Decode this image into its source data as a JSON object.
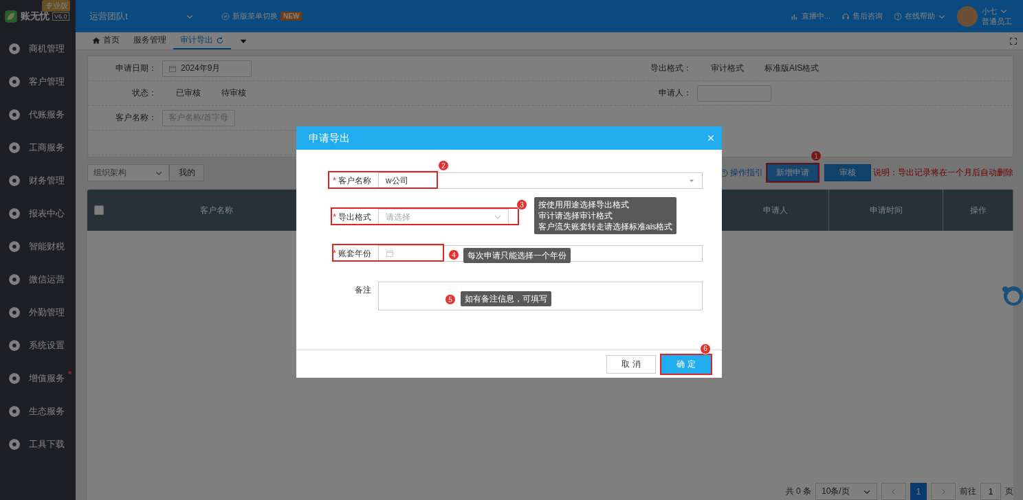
{
  "brand": {
    "name": "账无忧",
    "version": "V6.0",
    "edition": "专业版"
  },
  "topbar": {
    "team": "运营团队t",
    "menu_switch": "新版菜单切换",
    "badge": "NEW",
    "links": [
      {
        "kind": "live",
        "label": "直播中..."
      },
      {
        "kind": "support",
        "label": "售后咨询"
      },
      {
        "kind": "help",
        "label": "在线帮助"
      }
    ],
    "user": {
      "name": "小七",
      "role": "普通员工"
    }
  },
  "sidebar": {
    "items": [
      {
        "label": "商机管理",
        "notify": false
      },
      {
        "label": "客户管理",
        "notify": false
      },
      {
        "label": "代账服务",
        "notify": false
      },
      {
        "label": "工商服务",
        "notify": false
      },
      {
        "label": "财务管理",
        "notify": false
      },
      {
        "label": "报表中心",
        "notify": false
      },
      {
        "label": "智能财税",
        "notify": false
      },
      {
        "label": "微信运营",
        "notify": false
      },
      {
        "label": "外勤管理",
        "notify": false
      },
      {
        "label": "系统设置",
        "notify": false
      },
      {
        "label": "增值服务",
        "notify": true
      },
      {
        "label": "生态服务",
        "notify": false
      },
      {
        "label": "工具下载",
        "notify": false
      }
    ]
  },
  "tabs": [
    {
      "label": "首页",
      "selected": false,
      "kind": "home"
    },
    {
      "label": "服务管理",
      "selected": false,
      "kind": "plain"
    },
    {
      "label": "审计导出",
      "selected": true,
      "kind": "refresh"
    }
  ],
  "filters": {
    "left": [
      {
        "label": "申请日期：",
        "kind": "date",
        "value": "2024年9月"
      },
      {
        "label": "状态：",
        "kind": "options",
        "options": [
          "已审核",
          "待审核"
        ]
      },
      {
        "label": "客户名称：",
        "kind": "input",
        "placeholder": "客户名称/首字母"
      }
    ],
    "right": [
      {
        "label": "导出格式：",
        "kind": "options",
        "options": [
          "审计格式",
          "标准版AIS格式"
        ]
      },
      {
        "label": "申请人：",
        "kind": "input"
      }
    ]
  },
  "toolbar": {
    "org_select": "组织架构",
    "mine_button": "我的",
    "guide_link": "操作指引",
    "buttons": [
      {
        "label": "新增申请",
        "kind": "outline",
        "step": "1"
      },
      {
        "label": "审核",
        "kind": "solid"
      }
    ],
    "note": "说明：导出记录将在一个月后自动删除"
  },
  "table": {
    "select_all_checked": false,
    "columns": [
      "客户名称",
      "申请人",
      "申请时间",
      "操作"
    ]
  },
  "dialog": {
    "title": "申请导出",
    "fields": [
      {
        "label": "客户名称",
        "required_mark": "*",
        "kind": "select",
        "value": "w公司",
        "step": "2"
      },
      {
        "label": "导出格式",
        "required_mark": "*",
        "kind": "dropdown",
        "placeholder": "请选择",
        "step": "3",
        "tip": [
          "按使用用途选择导出格式",
          "审计请选择审计格式",
          "客户流失账套转走请选择标准ais格式"
        ]
      },
      {
        "label": "账套年份",
        "required_mark": "*",
        "kind": "year",
        "step": "4",
        "tip": [
          "每次申请只能选择一个年份"
        ]
      },
      {
        "label": "备注",
        "kind": "textarea",
        "step": "5",
        "tip": [
          "如有备注信息，可填写"
        ]
      }
    ],
    "buttons": [
      {
        "label": "取 消",
        "kind": "secondary"
      },
      {
        "label": "确 定",
        "kind": "primary",
        "step": "6"
      }
    ]
  },
  "pagination": {
    "total": "共 0 条",
    "page_size": "10条/页",
    "pages": [
      {
        "label": "1",
        "selected": true
      }
    ],
    "goto_label": "前往",
    "goto_value": "1",
    "goto_suffix": "页"
  }
}
